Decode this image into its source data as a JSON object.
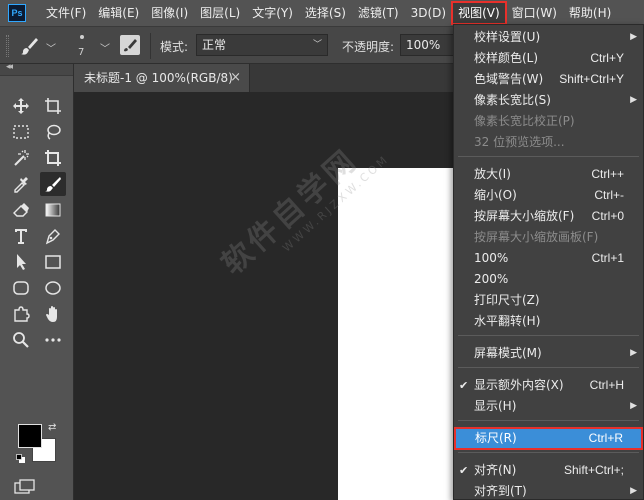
{
  "menubar": {
    "logo": "Ps",
    "items": [
      "文件(F)",
      "编辑(E)",
      "图像(I)",
      "图层(L)",
      "文字(Y)",
      "选择(S)",
      "滤镜(T)",
      "3D(D)",
      "视图(V)",
      "窗口(W)",
      "帮助(H)"
    ],
    "active_index": 8
  },
  "options": {
    "brush_size": "7",
    "mode_label": "模式:",
    "mode_value": "正常",
    "opacity_label": "不透明度:",
    "opacity_value": "100%"
  },
  "tab": {
    "title": "未标题-1 @ 100%(RGB/8)",
    "close": "×"
  },
  "toolbar": {
    "collapse": "◂◂"
  },
  "watermark": {
    "text": "软件自学网",
    "url": "WWW.RJZXW.COM"
  },
  "view_menu": {
    "items": [
      {
        "label": "校样设置(U)",
        "shortcut": "",
        "submenu": true,
        "disabled": false
      },
      {
        "label": "校样颜色(L)",
        "shortcut": "Ctrl+Y",
        "submenu": false,
        "disabled": false
      },
      {
        "label": "色域警告(W)",
        "shortcut": "Shift+Ctrl+Y",
        "submenu": false,
        "disabled": false
      },
      {
        "label": "像素长宽比(S)",
        "shortcut": "",
        "submenu": true,
        "disabled": false
      },
      {
        "label": "像素长宽比校正(P)",
        "shortcut": "",
        "submenu": false,
        "disabled": true
      },
      {
        "label": "32 位预览选项...",
        "shortcut": "",
        "submenu": false,
        "disabled": true
      },
      {
        "label": "放大(I)",
        "shortcut": "Ctrl++",
        "submenu": false,
        "disabled": false
      },
      {
        "label": "缩小(O)",
        "shortcut": "Ctrl+-",
        "submenu": false,
        "disabled": false
      },
      {
        "label": "按屏幕大小缩放(F)",
        "shortcut": "Ctrl+0",
        "submenu": false,
        "disabled": false
      },
      {
        "label": "按屏幕大小缩放画板(F)",
        "shortcut": "",
        "submenu": false,
        "disabled": true
      },
      {
        "label": "100%",
        "shortcut": "Ctrl+1",
        "submenu": false,
        "disabled": false
      },
      {
        "label": "200%",
        "shortcut": "",
        "submenu": false,
        "disabled": false
      },
      {
        "label": "打印尺寸(Z)",
        "shortcut": "",
        "submenu": false,
        "disabled": false
      },
      {
        "label": "水平翻转(H)",
        "shortcut": "",
        "submenu": false,
        "disabled": false
      },
      {
        "label": "屏幕模式(M)",
        "shortcut": "",
        "submenu": true,
        "disabled": false
      },
      {
        "label": "显示额外内容(X)",
        "shortcut": "Ctrl+H",
        "submenu": false,
        "disabled": false,
        "checked": true
      },
      {
        "label": "显示(H)",
        "shortcut": "",
        "submenu": true,
        "disabled": false
      },
      {
        "label": "标尺(R)",
        "shortcut": "Ctrl+R",
        "submenu": false,
        "disabled": false,
        "highlighted": true
      },
      {
        "label": "对齐(N)",
        "shortcut": "Shift+Ctrl+;",
        "submenu": false,
        "disabled": false,
        "checked": true
      },
      {
        "label": "对齐到(T)",
        "shortcut": "",
        "submenu": true,
        "disabled": false
      }
    ],
    "check_glyph": "✔",
    "submenu_glyph": "▶"
  },
  "colors": {
    "accent_highlight": "#3b8ed8",
    "annotation_red": "#e8302b",
    "menubar_bg": "#535353",
    "menu_bg": "#414141"
  }
}
